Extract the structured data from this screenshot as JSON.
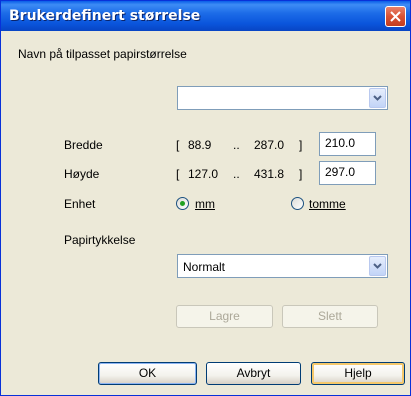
{
  "window": {
    "title": "Brukerdefinert størrelse"
  },
  "name_section": {
    "label": "Navn på tilpasset papirstørrelse",
    "value": ""
  },
  "width": {
    "label": "Bredde",
    "range_open": "[",
    "min": "88.9",
    "separator": "..",
    "max": "287.0",
    "range_close": "]",
    "value": "210.0"
  },
  "height": {
    "label": "Høyde",
    "range_open": "[",
    "min": "127.0",
    "separator": "..",
    "max": "431.8",
    "range_close": "]",
    "value": "297.0"
  },
  "unit": {
    "label": "Enhet",
    "options": [
      {
        "label": "mm",
        "selected": true
      },
      {
        "label": "tomme",
        "selected": false
      }
    ]
  },
  "thickness": {
    "label": "Papirtykkelse",
    "value": "Normalt"
  },
  "actions": {
    "save": "Lagre",
    "delete": "Slett"
  },
  "footer": {
    "ok": "OK",
    "cancel": "Avbryt",
    "help": "Hjelp"
  },
  "colors": {
    "titlebar": "#0a55dc",
    "window_bg": "#ece9d8",
    "close_button": "#d95234",
    "radio_selected": "#21a121",
    "field_border": "#7f9db9"
  }
}
